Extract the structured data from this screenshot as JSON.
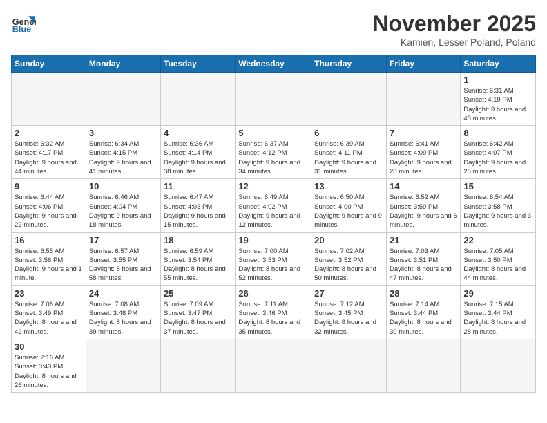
{
  "logo": {
    "text_general": "General",
    "text_blue": "Blue"
  },
  "header": {
    "month_title": "November 2025",
    "subtitle": "Kamien, Lesser Poland, Poland"
  },
  "weekdays": [
    "Sunday",
    "Monday",
    "Tuesday",
    "Wednesday",
    "Thursday",
    "Friday",
    "Saturday"
  ],
  "weeks": [
    {
      "days": [
        {
          "num": "",
          "info": ""
        },
        {
          "num": "",
          "info": ""
        },
        {
          "num": "",
          "info": ""
        },
        {
          "num": "",
          "info": ""
        },
        {
          "num": "",
          "info": ""
        },
        {
          "num": "",
          "info": ""
        },
        {
          "num": "1",
          "info": "Sunrise: 6:31 AM\nSunset: 4:19 PM\nDaylight: 9 hours and 48 minutes."
        }
      ]
    },
    {
      "days": [
        {
          "num": "2",
          "info": "Sunrise: 6:32 AM\nSunset: 4:17 PM\nDaylight: 9 hours and 44 minutes."
        },
        {
          "num": "3",
          "info": "Sunrise: 6:34 AM\nSunset: 4:15 PM\nDaylight: 9 hours and 41 minutes."
        },
        {
          "num": "4",
          "info": "Sunrise: 6:36 AM\nSunset: 4:14 PM\nDaylight: 9 hours and 38 minutes."
        },
        {
          "num": "5",
          "info": "Sunrise: 6:37 AM\nSunset: 4:12 PM\nDaylight: 9 hours and 34 minutes."
        },
        {
          "num": "6",
          "info": "Sunrise: 6:39 AM\nSunset: 4:11 PM\nDaylight: 9 hours and 31 minutes."
        },
        {
          "num": "7",
          "info": "Sunrise: 6:41 AM\nSunset: 4:09 PM\nDaylight: 9 hours and 28 minutes."
        },
        {
          "num": "8",
          "info": "Sunrise: 6:42 AM\nSunset: 4:07 PM\nDaylight: 9 hours and 25 minutes."
        }
      ]
    },
    {
      "days": [
        {
          "num": "9",
          "info": "Sunrise: 6:44 AM\nSunset: 4:06 PM\nDaylight: 9 hours and 22 minutes."
        },
        {
          "num": "10",
          "info": "Sunrise: 6:46 AM\nSunset: 4:04 PM\nDaylight: 9 hours and 18 minutes."
        },
        {
          "num": "11",
          "info": "Sunrise: 6:47 AM\nSunset: 4:03 PM\nDaylight: 9 hours and 15 minutes."
        },
        {
          "num": "12",
          "info": "Sunrise: 6:49 AM\nSunset: 4:02 PM\nDaylight: 9 hours and 12 minutes."
        },
        {
          "num": "13",
          "info": "Sunrise: 6:50 AM\nSunset: 4:00 PM\nDaylight: 9 hours and 9 minutes."
        },
        {
          "num": "14",
          "info": "Sunrise: 6:52 AM\nSunset: 3:59 PM\nDaylight: 9 hours and 6 minutes."
        },
        {
          "num": "15",
          "info": "Sunrise: 6:54 AM\nSunset: 3:58 PM\nDaylight: 9 hours and 3 minutes."
        }
      ]
    },
    {
      "days": [
        {
          "num": "16",
          "info": "Sunrise: 6:55 AM\nSunset: 3:56 PM\nDaylight: 9 hours and 1 minute."
        },
        {
          "num": "17",
          "info": "Sunrise: 6:57 AM\nSunset: 3:55 PM\nDaylight: 8 hours and 58 minutes."
        },
        {
          "num": "18",
          "info": "Sunrise: 6:59 AM\nSunset: 3:54 PM\nDaylight: 8 hours and 55 minutes."
        },
        {
          "num": "19",
          "info": "Sunrise: 7:00 AM\nSunset: 3:53 PM\nDaylight: 8 hours and 52 minutes."
        },
        {
          "num": "20",
          "info": "Sunrise: 7:02 AM\nSunset: 3:52 PM\nDaylight: 8 hours and 50 minutes."
        },
        {
          "num": "21",
          "info": "Sunrise: 7:03 AM\nSunset: 3:51 PM\nDaylight: 8 hours and 47 minutes."
        },
        {
          "num": "22",
          "info": "Sunrise: 7:05 AM\nSunset: 3:50 PM\nDaylight: 8 hours and 44 minutes."
        }
      ]
    },
    {
      "days": [
        {
          "num": "23",
          "info": "Sunrise: 7:06 AM\nSunset: 3:49 PM\nDaylight: 8 hours and 42 minutes."
        },
        {
          "num": "24",
          "info": "Sunrise: 7:08 AM\nSunset: 3:48 PM\nDaylight: 8 hours and 39 minutes."
        },
        {
          "num": "25",
          "info": "Sunrise: 7:09 AM\nSunset: 3:47 PM\nDaylight: 8 hours and 37 minutes."
        },
        {
          "num": "26",
          "info": "Sunrise: 7:11 AM\nSunset: 3:46 PM\nDaylight: 8 hours and 35 minutes."
        },
        {
          "num": "27",
          "info": "Sunrise: 7:12 AM\nSunset: 3:45 PM\nDaylight: 8 hours and 32 minutes."
        },
        {
          "num": "28",
          "info": "Sunrise: 7:14 AM\nSunset: 3:44 PM\nDaylight: 8 hours and 30 minutes."
        },
        {
          "num": "29",
          "info": "Sunrise: 7:15 AM\nSunset: 3:44 PM\nDaylight: 8 hours and 28 minutes."
        }
      ]
    },
    {
      "days": [
        {
          "num": "30",
          "info": "Sunrise: 7:16 AM\nSunset: 3:43 PM\nDaylight: 8 hours and 26 minutes."
        },
        {
          "num": "",
          "info": ""
        },
        {
          "num": "",
          "info": ""
        },
        {
          "num": "",
          "info": ""
        },
        {
          "num": "",
          "info": ""
        },
        {
          "num": "",
          "info": ""
        },
        {
          "num": "",
          "info": ""
        }
      ]
    }
  ]
}
